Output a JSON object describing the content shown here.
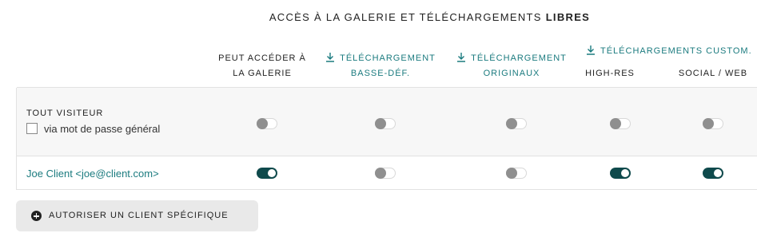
{
  "title": {
    "prefix": "ACCÈS À LA GALERIE ET TÉLÉCHARGEMENTS",
    "bold": "LIBRES"
  },
  "columns": {
    "gallery": {
      "line1": "PEUT ACCÉDER À",
      "line2": "LA GALERIE"
    },
    "low_res": {
      "line1": "TÉLÉCHARGEMENT",
      "line2": "BASSE-DÉF.",
      "icon": "download-icon"
    },
    "originals": {
      "line1": "TÉLÉCHARGEMENT",
      "line2": "ORIGINAUX",
      "icon": "download-icon"
    },
    "custom": {
      "label": "TÉLÉCHARGEMENTS CUSTOM.",
      "icon": "download-icon"
    },
    "high_res": {
      "label": "HIGH-RES"
    },
    "social_web": {
      "label": "SOCIAL / WEB"
    }
  },
  "rows": {
    "visitor": {
      "title": "TOUT VISITEUR",
      "password_label": "via mot de passe général",
      "password_checked": false,
      "toggles": {
        "gallery": false,
        "low_res": false,
        "originals": false,
        "high_res": false,
        "social_web": false
      }
    },
    "client": {
      "label": "Joe Client <joe@client.com>",
      "toggles": {
        "gallery": true,
        "low_res": false,
        "originals": false,
        "high_res": true,
        "social_web": true
      }
    }
  },
  "add_client_button": {
    "label": "AUTORISER UN CLIENT SPÉCIFIQUE",
    "icon": "plus-circle-icon"
  },
  "colors": {
    "accent": "#1b7b7f",
    "toggle_on": "#0f4a4c",
    "toggle_off_knob": "#8f8f8f",
    "row_bg": "#f7f7f7"
  }
}
